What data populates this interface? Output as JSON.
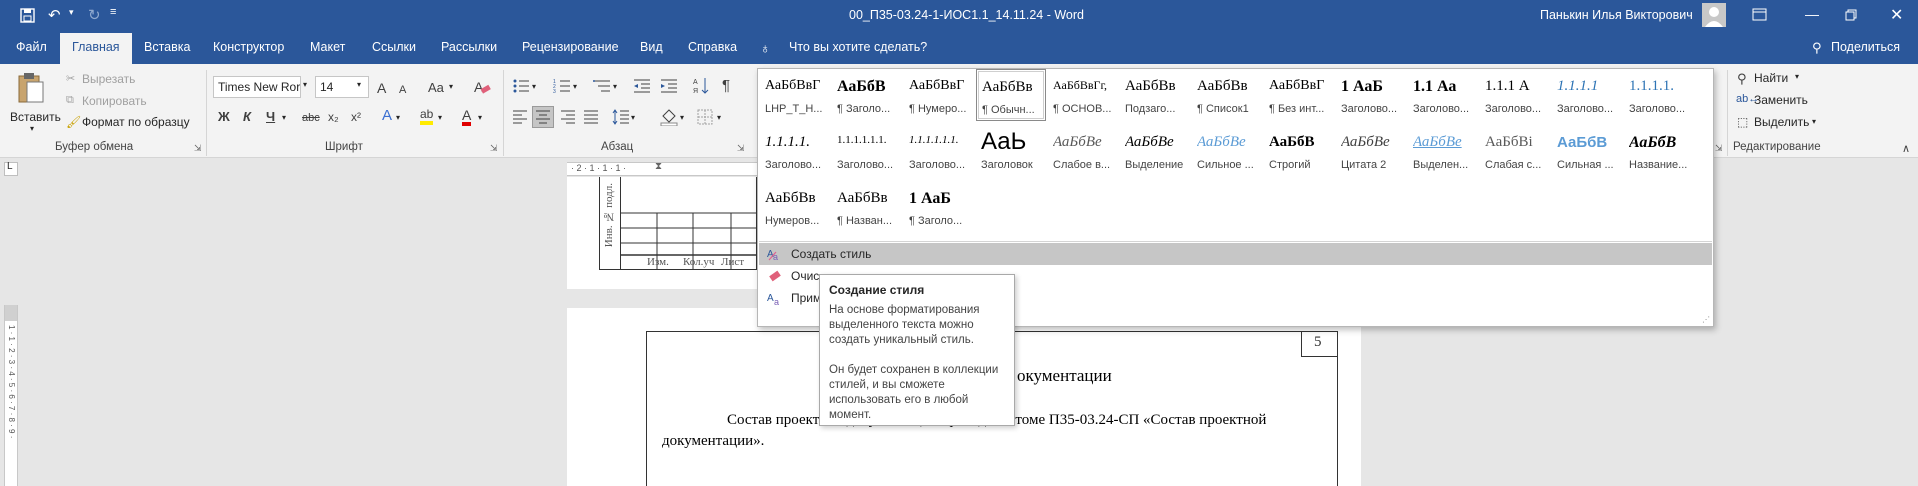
{
  "titlebar": {
    "doc_title": "00_П35-03.24-1-ИОС1.1_14.11.24  -  Word",
    "user_name": "Панькин Илья Викторович"
  },
  "tabs": {
    "file": "Файл",
    "home": "Главная",
    "insert": "Вставка",
    "design": "Конструктор",
    "layout": "Макет",
    "references": "Ссылки",
    "mailings": "Рассылки",
    "review": "Рецензирование",
    "view": "Вид",
    "help": "Справка",
    "tell_me": "Что вы хотите сделать?",
    "share": "Поделиться"
  },
  "clipboard": {
    "paste": "Вставить",
    "cut": "Вырезать",
    "copy": "Копировать",
    "format_painter": "Формат по образцу",
    "label": "Буфер обмена"
  },
  "font": {
    "name": "Times New Ror",
    "size": "14",
    "label": "Шрифт",
    "grow": "A",
    "shrink": "A",
    "case": "Aa",
    "bold": "Ж",
    "italic": "К",
    "underline": "Ч",
    "strike": "abc",
    "subscript": "x₂",
    "superscript": "x²",
    "effects": "A",
    "highlight": "ab",
    "color": "A"
  },
  "paragraph": {
    "label": "Абзац"
  },
  "editing": {
    "find": "Найти",
    "replace": "Заменить",
    "select": "Выделить",
    "label": "Редактирование"
  },
  "ruler": {
    "marks": "· 2 · 1 · 1 · 1 ·"
  },
  "styles_gallery": {
    "rows": [
      [
        {
          "preview": "АаБбВвГ",
          "name": "LHP_T_H..."
        },
        {
          "preview": "АаБбВ",
          "name": "¶ Заголо..."
        },
        {
          "preview": "АаБбВвГ",
          "name": "¶ Нумеро..."
        },
        {
          "preview": "АаБбВв",
          "name": "¶ Обычн..."
        },
        {
          "preview": "АаБбВвГг,",
          "name": "¶ ОСНОВ..."
        },
        {
          "preview": "АаБбВв",
          "name": "Подзаго..."
        },
        {
          "preview": "АаБбВв",
          "name": "¶ Список1"
        },
        {
          "preview": "АаБбВвГ",
          "name": "¶ Без инт..."
        },
        {
          "preview": "1  АаБ",
          "name": "Заголово..."
        },
        {
          "preview": "1.1  Аа",
          "name": "Заголово..."
        },
        {
          "preview": "1.1.1  А",
          "name": "Заголово..."
        },
        {
          "preview": "1.1.1.1",
          "name": "Заголово..."
        },
        {
          "preview": "1.1.1.1.",
          "name": "Заголово..."
        }
      ],
      [
        {
          "preview": "1.1.1.1.",
          "name": "Заголово..."
        },
        {
          "preview": "1.1.1.1.1.1.",
          "name": "Заголово..."
        },
        {
          "preview": "1.1.1.1.1.1.",
          "name": "Заголово..."
        },
        {
          "preview": "АаЬ",
          "name": "Заголовок"
        },
        {
          "preview": "АаБбВе",
          "name": "Слабое в..."
        },
        {
          "preview": "АаБбВе",
          "name": "Выделение"
        },
        {
          "preview": "АаБбВе",
          "name": "Сильное ..."
        },
        {
          "preview": "АаБбВ",
          "name": "Строгий"
        },
        {
          "preview": "АаБбВе",
          "name": "Цитата 2"
        },
        {
          "preview": "АаБбВе",
          "name": "Выделен..."
        },
        {
          "preview": "АаБбВі",
          "name": "Слабая с..."
        },
        {
          "preview": "АаБбВ",
          "name": "Сильная ..."
        },
        {
          "preview": "АаБбВ",
          "name": "Название..."
        }
      ],
      [
        {
          "preview": "АаБбВв",
          "name": "Нумеров..."
        },
        {
          "preview": "АаБбВв",
          "name": "¶ Назван..."
        },
        {
          "preview": "1  АаБ",
          "name": "¶ Заголо..."
        }
      ]
    ],
    "menu": {
      "create_style": "Создать стиль",
      "clear_format": "Очис",
      "apply_styles": "Прим"
    }
  },
  "tooltip": {
    "title": "Создание стиля",
    "para1": "На основе форматирования выделенного текста можно создать уникальный стиль.",
    "para2": "Он будет сохранен в коллекции стилей, и вы сможете использовать его в любой момент."
  },
  "document": {
    "stamp_vertical": "Инв. № подл.",
    "stamp_cols": [
      "Изм.",
      "Кол.уч",
      "Лист"
    ],
    "page_number": "5",
    "heading_fragment": "окументации",
    "body_line1": "Состав проектной документации приведен в томе П35-03.24-СП «Состав проектной",
    "body_line2": "документации»."
  },
  "vruler": {
    "marks": "1 · 1 · 2 · 3 · 4 · 5 · 6 · 7 · 8 · 9 ·"
  }
}
